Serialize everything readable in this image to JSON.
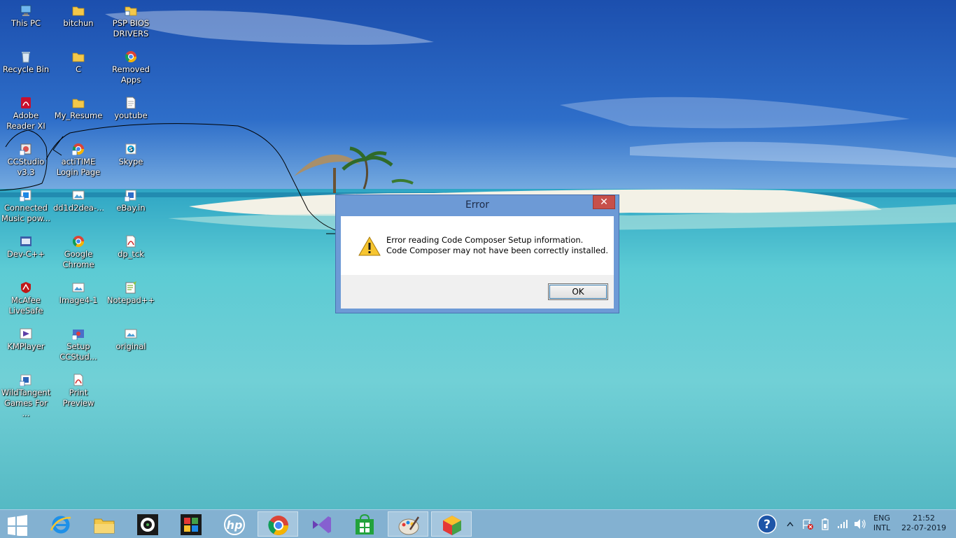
{
  "desktop": {
    "icons": [
      {
        "label": "This PC",
        "icon": "this-pc-icon"
      },
      {
        "label": "bitchun",
        "icon": "folder-icon"
      },
      {
        "label": "PSP BIOS\nDRIVERS",
        "icon": "folder-shortcut-icon"
      },
      {
        "label": "Recycle Bin",
        "icon": "recycle-bin-icon"
      },
      {
        "label": "C",
        "icon": "folder-icon"
      },
      {
        "label": "Removed\nApps",
        "icon": "chrome-icon"
      },
      {
        "label": "Adobe\nReader XI",
        "icon": "adobe-reader-icon"
      },
      {
        "label": "My_Resume",
        "icon": "folder-icon"
      },
      {
        "label": "youtube",
        "icon": "document-icon"
      },
      {
        "label": "CCStudio\nv3.3",
        "icon": "ccstudio-icon"
      },
      {
        "label": "actiTIME\nLogin Page",
        "icon": "chrome-shortcut-icon"
      },
      {
        "label": "Skype",
        "icon": "skype-icon"
      },
      {
        "label": "Connected\nMusic pow...",
        "icon": "music-app-icon"
      },
      {
        "label": "dd1d2dea-...",
        "icon": "image-file-icon"
      },
      {
        "label": "eBay.in",
        "icon": "ebay-shortcut-icon"
      },
      {
        "label": "Dev-C++",
        "icon": "devcpp-icon"
      },
      {
        "label": "Google\nChrome",
        "icon": "chrome-icon"
      },
      {
        "label": "dp_tck",
        "icon": "pdf-icon"
      },
      {
        "label": "McAfee\nLiveSafe",
        "icon": "mcafee-icon"
      },
      {
        "label": "Image4-1",
        "icon": "image-file-icon"
      },
      {
        "label": "Notepad++",
        "icon": "notepadpp-icon"
      },
      {
        "label": "KMPlayer",
        "icon": "kmplayer-icon"
      },
      {
        "label": "Setup\nCCStud...",
        "icon": "setup-icon"
      },
      {
        "label": "original",
        "icon": "image-file-icon"
      },
      {
        "label": "WildTangent\nGames For ...",
        "icon": "wildtangent-icon"
      },
      {
        "label": "Print Preview",
        "icon": "pdf-icon"
      }
    ]
  },
  "dialog": {
    "title": "Error",
    "close_label": "✕",
    "message_line1": "Error reading Code Composer Setup information.",
    "message_line2": "Code Composer may not have been correctly installed.",
    "ok_label": "OK",
    "icon": "warning-icon"
  },
  "taskbar": {
    "pinned": [
      {
        "name": "start",
        "icon": "windows-start-icon"
      },
      {
        "name": "internet-explorer",
        "icon": "internet-explorer-icon"
      },
      {
        "name": "file-explorer",
        "icon": "file-explorer-icon"
      },
      {
        "name": "webcam",
        "icon": "webcam-icon"
      },
      {
        "name": "app-puzzle",
        "icon": "puzzle-app-icon"
      },
      {
        "name": "hp",
        "icon": "hp-icon"
      },
      {
        "name": "chrome",
        "icon": "chrome-icon",
        "active": true
      },
      {
        "name": "visual-studio",
        "icon": "visual-studio-icon"
      },
      {
        "name": "store",
        "icon": "store-icon"
      },
      {
        "name": "paint",
        "icon": "paint-icon",
        "active": true
      },
      {
        "name": "cube-app",
        "icon": "cube-app-icon",
        "active": true
      }
    ],
    "tray": {
      "language": "ENG",
      "layout": "INTL",
      "time": "21:52",
      "date": "22-07-2019",
      "icons": [
        "help-icon",
        "show-hidden-icons-icon",
        "action-center-icon",
        "battery-icon",
        "wifi-signal-icon",
        "speaker-icon"
      ]
    }
  },
  "colors": {
    "sky": "#1f58b4",
    "sea": "#5fc3cf",
    "taskbar": "#78aacd",
    "dialog_frame": "#6d9ad6",
    "close_button": "#c7504b"
  }
}
